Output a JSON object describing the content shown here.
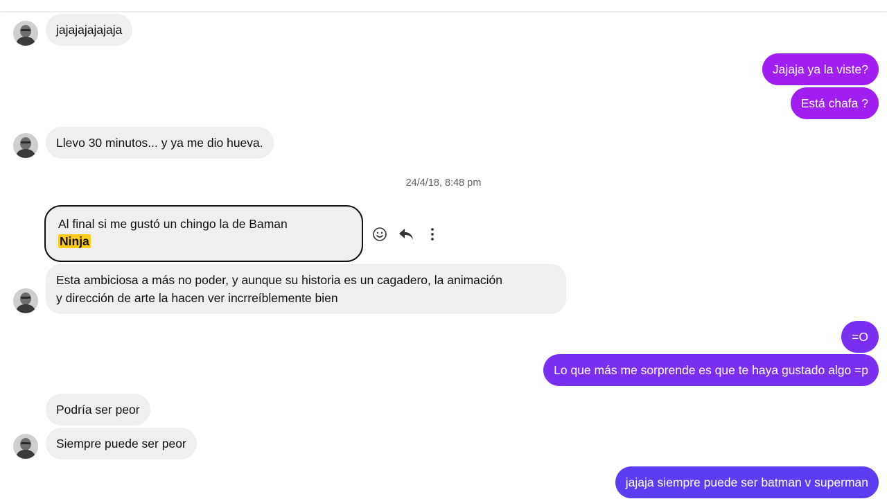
{
  "conversation": {
    "timestamp": "24/4/18, 8:48 pm",
    "messages": [
      {
        "text": "jajajajajajaja"
      },
      {
        "text": "Jajaja ya la viste?"
      },
      {
        "text": "Está chafa ?"
      },
      {
        "text": "Llevo 30 minutos... y ya me dio hueva."
      },
      {
        "text_before": "Al final si me gustó un chingo la de Baman",
        "highlight": "Ninja"
      },
      {
        "line1": "Esta ambiciosa a más no poder, y aunque su historia es un cagadero, la animación",
        "line2": "y dirección de arte la hacen ver incrreíblemente bien"
      },
      {
        "text": "=O"
      },
      {
        "text": "Lo que más me sorprende es que te haya gustado algo =p"
      },
      {
        "text": "Podría ser peor"
      },
      {
        "text": "Siempre puede ser peor"
      },
      {
        "text": "jajaja siempre puede ser batman v superman"
      }
    ]
  },
  "message_actions": {
    "react_icon": "smiley-icon",
    "reply_icon": "reply-arrow-icon",
    "more_icon": "more-vertical-icon"
  },
  "colors": {
    "incoming_bubble": "#efefef",
    "outgoing_purple": "#a01ef0",
    "outgoing_violet": "#7a2ff0",
    "outgoing_blue": "#5b3cf0",
    "highlight": "#ffcc1a"
  }
}
